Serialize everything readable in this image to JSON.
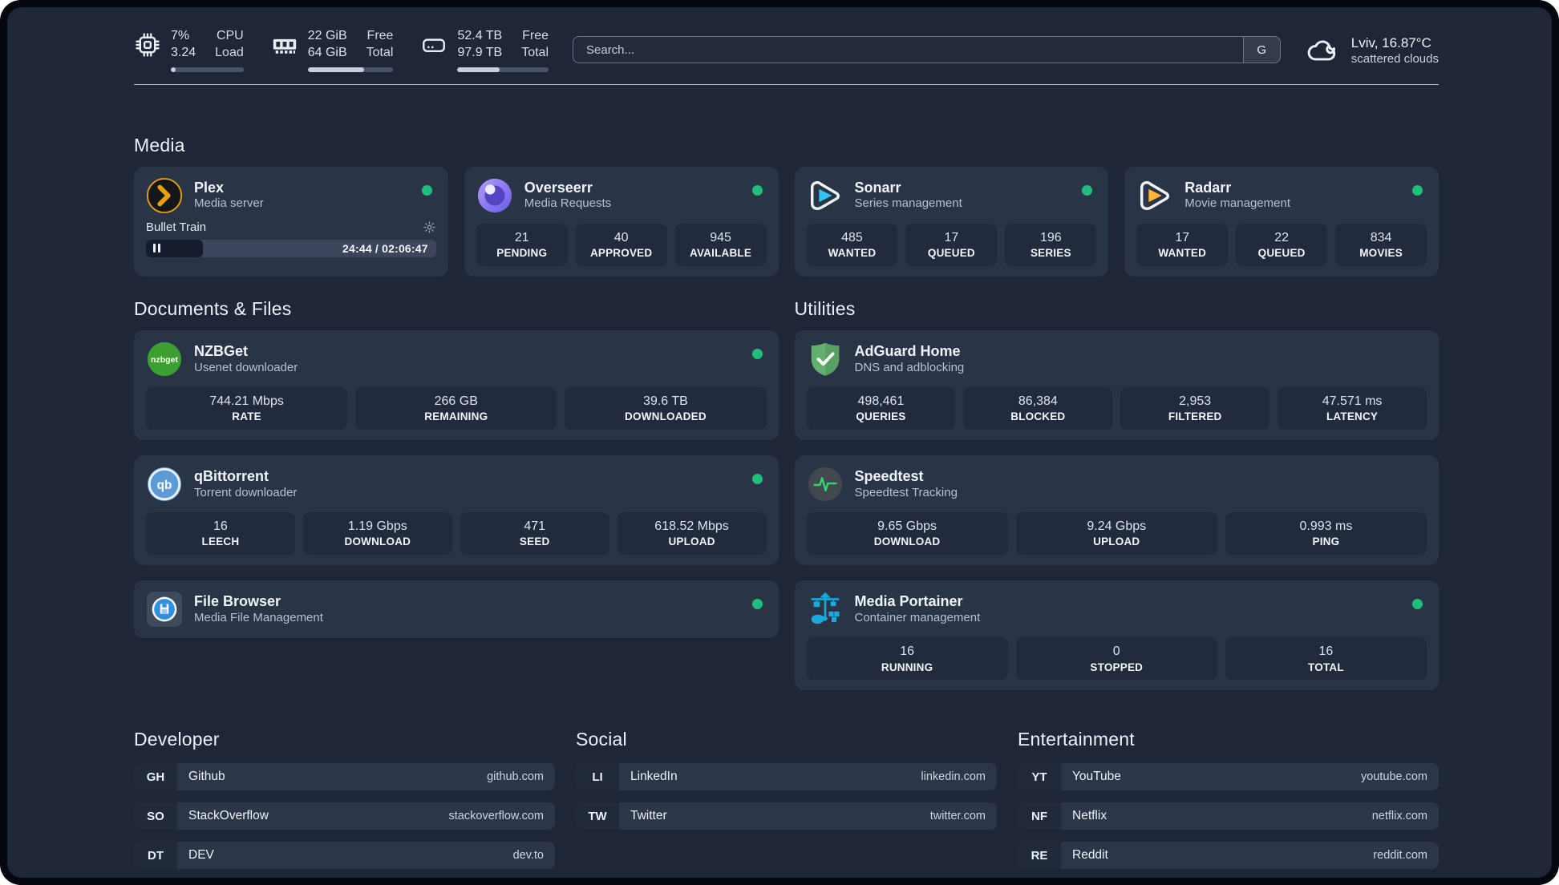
{
  "colors": {
    "status_online": "#1fbe7c",
    "accent_plex": "#e5a00d"
  },
  "header": {
    "widgets": [
      {
        "icon": "cpu-chip-icon",
        "col1": [
          "7%",
          "3.24"
        ],
        "col2": [
          "CPU",
          "Load"
        ],
        "progress_pct": 7
      },
      {
        "icon": "memory-icon",
        "col1": [
          "22 GiB",
          "64 GiB"
        ],
        "col2": [
          "Free",
          "Total"
        ],
        "progress_pct": 66
      },
      {
        "icon": "hard-drive-icon",
        "col1": [
          "52.4 TB",
          "97.9 TB"
        ],
        "col2": [
          "Free",
          "Total"
        ],
        "progress_pct": 46
      }
    ],
    "search": {
      "placeholder": "Search...",
      "engine_button_label": "G"
    },
    "weather": {
      "icon": "cloud-icon",
      "line1": "Lviv, 16.87°C",
      "line2": "scattered clouds"
    }
  },
  "media_section": {
    "title": "Media",
    "apps": [
      {
        "icon": "plex-icon",
        "name": "Plex",
        "description": "Media server",
        "online": true,
        "now_playing": {
          "title": "Bullet Train",
          "time": "24:44 / 02:06:47",
          "progress_pct": 19.5
        },
        "stats": []
      },
      {
        "icon": "overseerr-icon",
        "name": "Overseerr",
        "description": "Media Requests",
        "online": true,
        "stats": [
          {
            "value": "21",
            "label": "PENDING"
          },
          {
            "value": "40",
            "label": "APPROVED"
          },
          {
            "value": "945",
            "label": "AVAILABLE"
          }
        ]
      },
      {
        "icon": "sonarr-icon",
        "name": "Sonarr",
        "description": "Series management",
        "online": true,
        "stats": [
          {
            "value": "485",
            "label": "WANTED"
          },
          {
            "value": "17",
            "label": "QUEUED"
          },
          {
            "value": "196",
            "label": "SERIES"
          }
        ]
      },
      {
        "icon": "radarr-icon",
        "name": "Radarr",
        "description": "Movie management",
        "online": true,
        "stats": [
          {
            "value": "17",
            "label": "WANTED"
          },
          {
            "value": "22",
            "label": "QUEUED"
          },
          {
            "value": "834",
            "label": "MOVIES"
          }
        ]
      }
    ]
  },
  "documents_section": {
    "title": "Documents & Files",
    "apps": [
      {
        "icon": "nzbget-icon",
        "name": "NZBGet",
        "description": "Usenet downloader",
        "online": true,
        "stats": [
          {
            "value": "744.21 Mbps",
            "label": "RATE"
          },
          {
            "value": "266 GB",
            "label": "REMAINING"
          },
          {
            "value": "39.6 TB",
            "label": "DOWNLOADED"
          }
        ]
      },
      {
        "icon": "qbittorrent-icon",
        "name": "qBittorrent",
        "description": "Torrent downloader",
        "online": true,
        "stats": [
          {
            "value": "16",
            "label": "LEECH"
          },
          {
            "value": "1.19 Gbps",
            "label": "DOWNLOAD"
          },
          {
            "value": "471",
            "label": "SEED"
          },
          {
            "value": "618.52 Mbps",
            "label": "UPLOAD"
          }
        ]
      },
      {
        "icon": "filebrowser-icon",
        "name": "File Browser",
        "description": "Media File Management",
        "online": true,
        "stats": []
      }
    ]
  },
  "utilities_section": {
    "title": "Utilities",
    "apps": [
      {
        "icon": "adguard-icon",
        "name": "AdGuard Home",
        "description": "DNS and adblocking",
        "online": false,
        "stats": [
          {
            "value": "498,461",
            "label": "QUERIES"
          },
          {
            "value": "86,384",
            "label": "BLOCKED"
          },
          {
            "value": "2,953",
            "label": "FILTERED"
          },
          {
            "value": "47.571 ms",
            "label": "LATENCY"
          }
        ]
      },
      {
        "icon": "speedtest-icon",
        "name": "Speedtest",
        "description": "Speedtest Tracking",
        "online": false,
        "stats": [
          {
            "value": "9.65 Gbps",
            "label": "DOWNLOAD"
          },
          {
            "value": "9.24 Gbps",
            "label": "UPLOAD"
          },
          {
            "value": "0.993 ms",
            "label": "PING"
          }
        ]
      },
      {
        "icon": "portainer-icon",
        "name": "Media Portainer",
        "description": "Container management",
        "online": true,
        "stats": [
          {
            "value": "16",
            "label": "RUNNING"
          },
          {
            "value": "0",
            "label": "STOPPED"
          },
          {
            "value": "16",
            "label": "TOTAL"
          }
        ]
      }
    ]
  },
  "link_sections": [
    {
      "title": "Developer",
      "links": [
        {
          "abbr": "GH",
          "name": "Github",
          "domain": "github.com"
        },
        {
          "abbr": "SO",
          "name": "StackOverflow",
          "domain": "stackoverflow.com"
        },
        {
          "abbr": "DT",
          "name": "DEV",
          "domain": "dev.to"
        }
      ]
    },
    {
      "title": "Social",
      "links": [
        {
          "abbr": "LI",
          "name": "LinkedIn",
          "domain": "linkedin.com"
        },
        {
          "abbr": "TW",
          "name": "Twitter",
          "domain": "twitter.com"
        }
      ]
    },
    {
      "title": "Entertainment",
      "links": [
        {
          "abbr": "YT",
          "name": "YouTube",
          "domain": "youtube.com"
        },
        {
          "abbr": "NF",
          "name": "Netflix",
          "domain": "netflix.com"
        },
        {
          "abbr": "RE",
          "name": "Reddit",
          "domain": "reddit.com"
        }
      ]
    }
  ]
}
